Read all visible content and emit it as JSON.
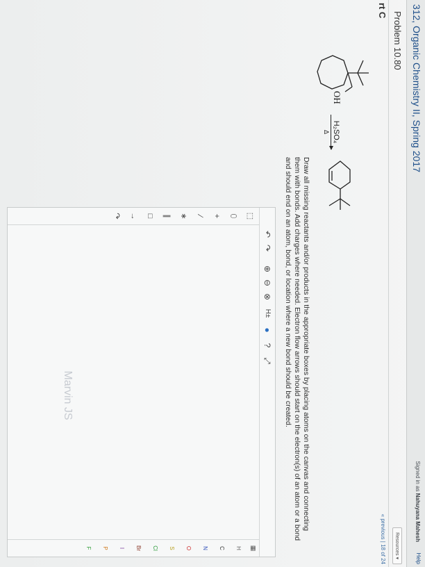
{
  "header": {
    "course_title": "312, Organic Chemistry II, Spring 2017",
    "signed_in_text": "Signed in as",
    "user_name": "Nahuyana Mahesh",
    "help_label": "Help"
  },
  "problem": {
    "title": "Problem 10.80",
    "resources_label": "Resources"
  },
  "part": {
    "label": "rt C",
    "pager_text": "« previous  |  18 of 24"
  },
  "reaction": {
    "reactant_label": "OH",
    "reagent": "H₂SO₄",
    "condition": "Δ"
  },
  "instructions": "Draw all missing reactants and/or products in the appropriate boxes by placing atoms on the canvas and connecting them with bonds. Add charges where needed. Electron flow arrows should start on the electron(s) of an atom or a bond and should end on an atom, bond, or location where a new bond should be created.",
  "editor": {
    "toolbar": [
      "↶",
      "↷",
      "⊕",
      "⊖",
      "⊗",
      "H±",
      "●",
      "?",
      "⤢"
    ],
    "left_tools": [
      "⬚",
      "⬯",
      "+",
      "∕",
      "∗",
      "∥",
      "□",
      "→",
      "↷"
    ],
    "elements": [
      "H",
      "C",
      "N",
      "O",
      "S",
      "Cl",
      "Br",
      "I",
      "P",
      "F"
    ],
    "watermark": "Marvin JS",
    "periodic_icon": "periodic-table-icon"
  },
  "colors": {
    "link": "#1e4f8a",
    "element_H": "#666666",
    "element_N": "#2f4fb8",
    "element_O": "#cc2b2b",
    "element_S": "#b8a020",
    "element_Cl": "#2b9a3a",
    "element_Br": "#8b3a2a",
    "element_I": "#7a3a9a",
    "element_P": "#d07a20",
    "element_F": "#3aa040"
  }
}
